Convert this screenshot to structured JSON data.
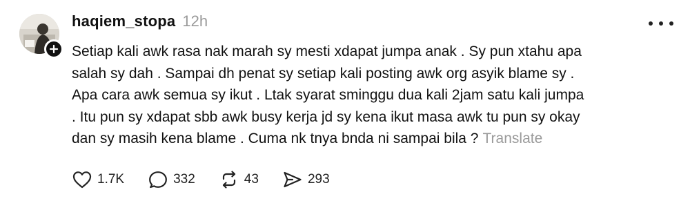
{
  "post": {
    "username": "haqiem_stopa",
    "time": "12h",
    "lines": [
      "Setiap kali awk rasa nak marah sy mesti xdapat jumpa anak . Sy pun xtahu apa",
      "salah sy dah . Sampai dh penat sy setiap kali posting awk org asyik blame sy .",
      "Apa cara awk semua sy ikut . Ltak syarat sminggu dua kali 2jam satu kali jumpa",
      ". Itu pun sy xdapat sbb awk busy kerja jd sy kena ikut masa awk tu pun sy okay",
      "dan sy masih kena blame . Cuma nk tnya bnda ni sampai bila ?"
    ],
    "translate_label": "Translate"
  },
  "actions": {
    "like": {
      "icon": "heart-icon",
      "count": "1.7K"
    },
    "reply": {
      "icon": "comment-icon",
      "count": "332"
    },
    "repost": {
      "icon": "repost-icon",
      "count": "43"
    },
    "share": {
      "icon": "share-icon",
      "count": "293"
    }
  },
  "colors": {
    "text": "#111111",
    "muted": "#9a9a9a",
    "background": "#ffffff"
  }
}
